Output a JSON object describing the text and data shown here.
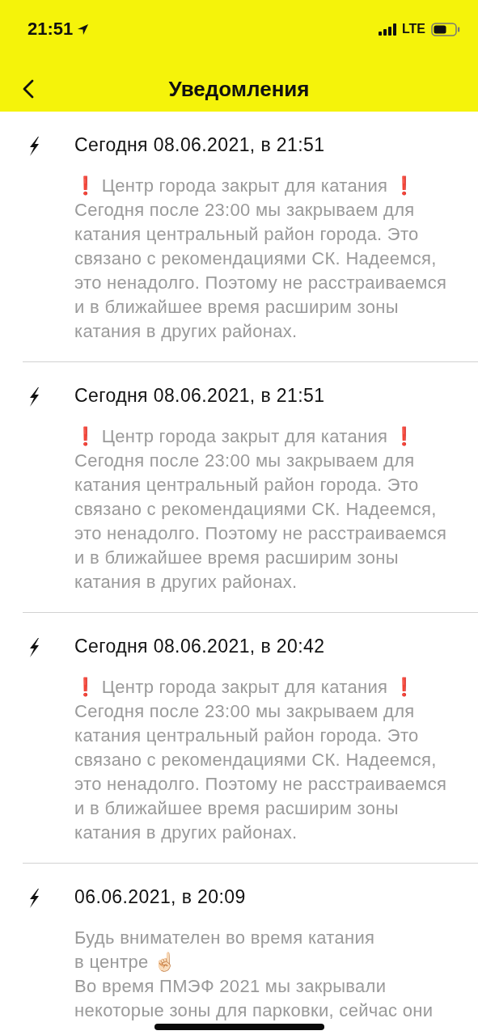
{
  "status_bar": {
    "time": "21:51",
    "network": "LTE"
  },
  "nav": {
    "title": "Уведомления"
  },
  "notifications": [
    {
      "date": "Сегодня 08.06.2021, в 21:51",
      "lines": [
        "❗ Центр города закрыт для катания ❗",
        "Сегодня после 23:00 мы закрываем для",
        "катания центральный район города. Это",
        "связано с рекомендациями СК. Надеемся,",
        "это ненадолго. Поэтому не расстраиваемся",
        "и в ближайшее время расширим зоны",
        "катания в других районах."
      ]
    },
    {
      "date": "Сегодня 08.06.2021, в 21:51",
      "lines": [
        "❗ Центр города закрыт для катания ❗",
        "Сегодня после 23:00 мы закрываем для",
        "катания центральный район города. Это",
        "связано с рекомендациями СК. Надеемся,",
        "это ненадолго. Поэтому не расстраиваемся",
        "и в ближайшее время расширим зоны",
        "катания в других районах."
      ]
    },
    {
      "date": "Сегодня 08.06.2021, в 20:42",
      "lines": [
        "❗ Центр города закрыт для катания ❗",
        "Сегодня после 23:00 мы закрываем для",
        "катания центральный район города. Это",
        "связано с рекомендациями СК. Надеемся,",
        "это ненадолго. Поэтому не расстраиваемся",
        "и в ближайшее время расширим зоны",
        "катания в других районах."
      ]
    },
    {
      "date": "06.06.2021, в 20:09",
      "lines": [
        "Будь внимателен во время катания",
        "в центре ☝🏻",
        "Во время ПМЭФ 2021 мы закрывали",
        "некоторые зоны для парковки, сейчас они"
      ]
    }
  ]
}
